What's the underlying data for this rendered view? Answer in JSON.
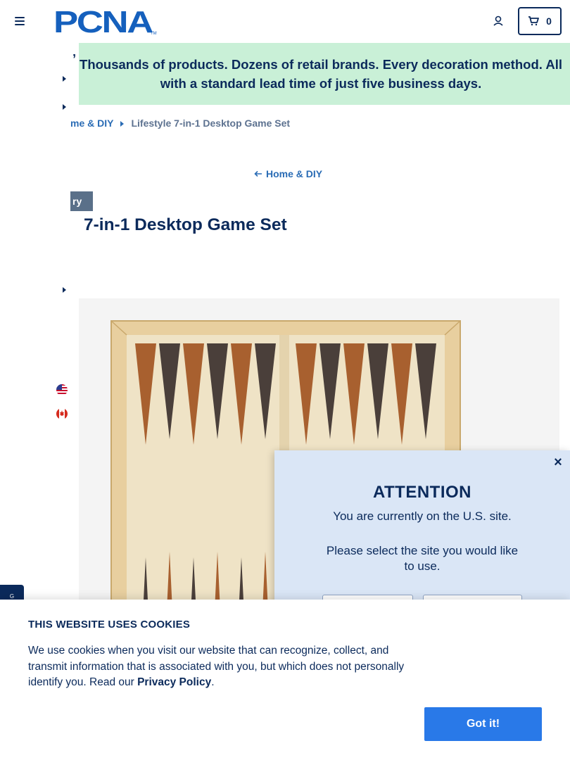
{
  "header": {
    "logo_text": "PCNA",
    "logo_tm": "TM",
    "cart_count": "0"
  },
  "promo": {
    "lead": "’",
    "text": "Thousands of products. Dozens of retail brands. Every decoration method. All with a standard lead time of just five business days."
  },
  "breadcrumb": {
    "parent": "me & DIY",
    "current": "Lifestyle 7-in-1 Desktop Game Set"
  },
  "back_link": {
    "label": "Home & DIY"
  },
  "badge": {
    "label": "ry"
  },
  "product": {
    "title": "7-in-1 Desktop Game Set"
  },
  "side_tab": {
    "label": "G"
  },
  "modal": {
    "title": "ATTENTION",
    "line1": "You are currently on the U.S. site.",
    "line2": "Please select the site you would like to use.",
    "close_glyph": "×"
  },
  "cookies": {
    "title": "THIS WEBSITE USES COOKIES",
    "text_before": "We use cookies when you visit our website that can recognize, collect, and transmit information that is associated with you, but which does not personally identify you. Read our ",
    "link": "Privacy Policy",
    "text_after": ".",
    "button": "Got it!"
  },
  "colors": {
    "navy": "#0b2a5b",
    "link_blue": "#2a6cb5",
    "promo_green": "#c9f0d7",
    "modal_bg": "#dae6f6",
    "button_blue": "#2979e8",
    "badge_gray": "#5a7089"
  },
  "icons": [
    "hamburger-icon",
    "user-icon",
    "cart-icon",
    "arrow-left-icon",
    "caret-right-icon",
    "us-flag-icon",
    "canada-flag-icon",
    "close-icon"
  ]
}
